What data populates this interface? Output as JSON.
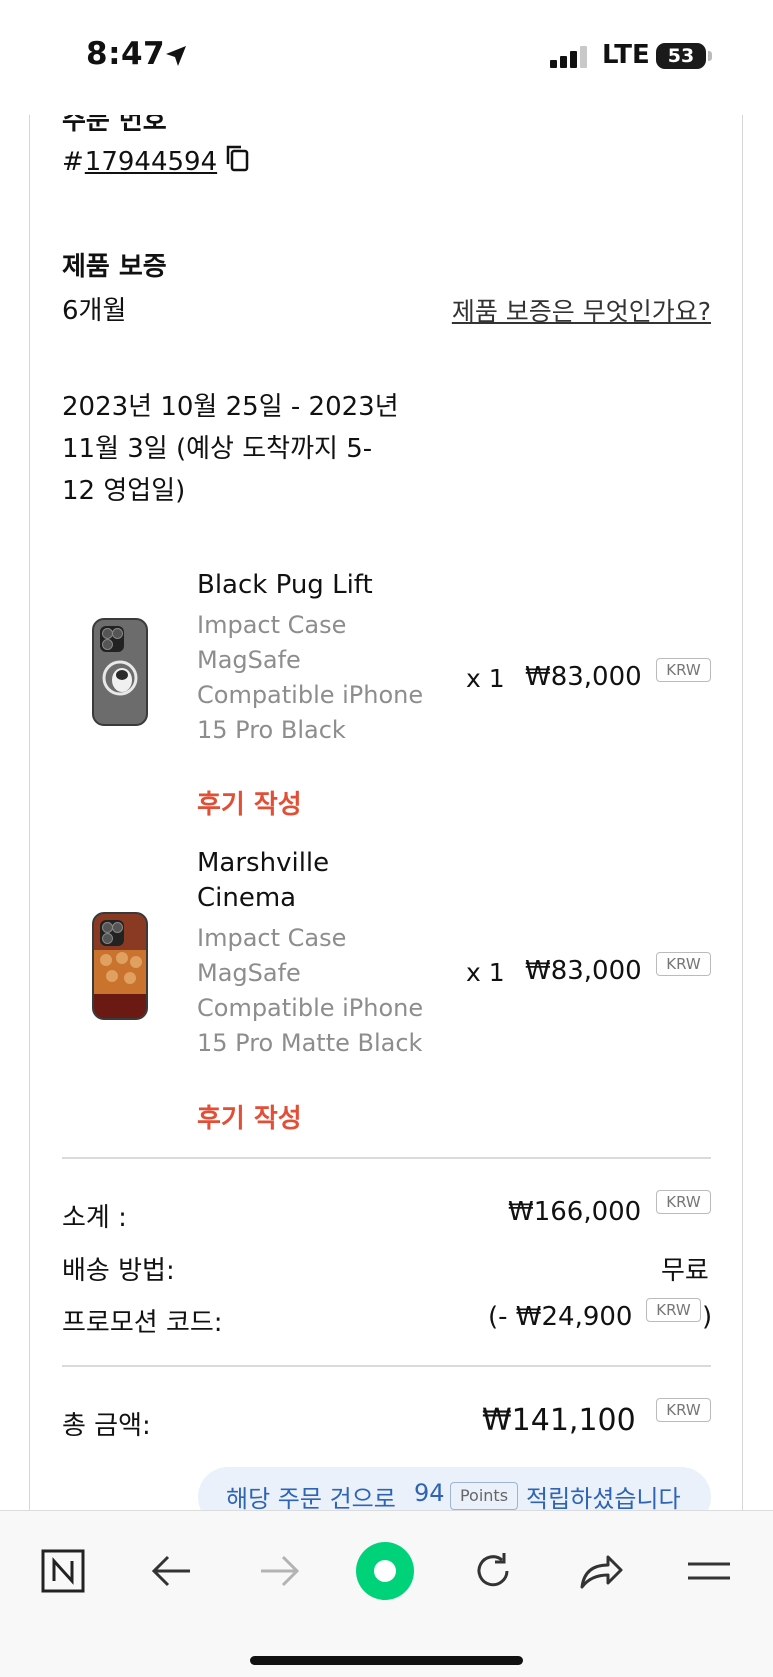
{
  "status_bar": {
    "time": "8:47",
    "network": "LTE",
    "battery": "53"
  },
  "order": {
    "label": "주문 번호",
    "number_prefix": "#",
    "number": "17944594"
  },
  "warranty": {
    "title": "제품 보증",
    "value": "6개월",
    "link": "제품 보증은 무엇인가요?"
  },
  "delivery": {
    "text": "2023년 10월 25일 - 2023년 11월 3일 (예상 도착까지 5-12 영업일)"
  },
  "items": [
    {
      "name": "Black Pug Lift",
      "variant": "Impact Case MagSafe Compatible iPhone 15 Pro Black",
      "review": "후기 작성",
      "qty": "x 1",
      "price": "₩83,000",
      "currency": "KRW"
    },
    {
      "name": "Marshville Cinema",
      "variant": "Impact Case MagSafe Compatible iPhone 15 Pro Matte Black",
      "review": "후기 작성",
      "qty": "x 1",
      "price": "₩83,000",
      "currency": "KRW"
    }
  ],
  "summary": {
    "subtotal_label": "소계 :",
    "subtotal_value": "₩166,000",
    "subtotal_currency": "KRW",
    "shipping_label": "배송 방법:",
    "shipping_value": "무료",
    "promo_label": "프로모션 코드:",
    "promo_value_prefix": "(- ₩24,900",
    "promo_currency": "KRW",
    "promo_value_suffix": ")",
    "total_label": "총 금액:",
    "total_value": "₩141,100",
    "total_currency": "KRW"
  },
  "points": {
    "prefix": "해당 주문 건으로",
    "amount": "94",
    "unit": "Points",
    "suffix": "적립하셨습니다"
  },
  "colors": {
    "accent_review": "#e24f36",
    "points_text": "#2f64b5",
    "points_bg": "#eaf1fb",
    "home_icon": "#00d27a"
  },
  "browser_nav": [
    "naver-n-icon",
    "back-arrow-icon",
    "forward-arrow-icon",
    "home-icon",
    "reload-icon",
    "share-icon",
    "menu-icon"
  ]
}
